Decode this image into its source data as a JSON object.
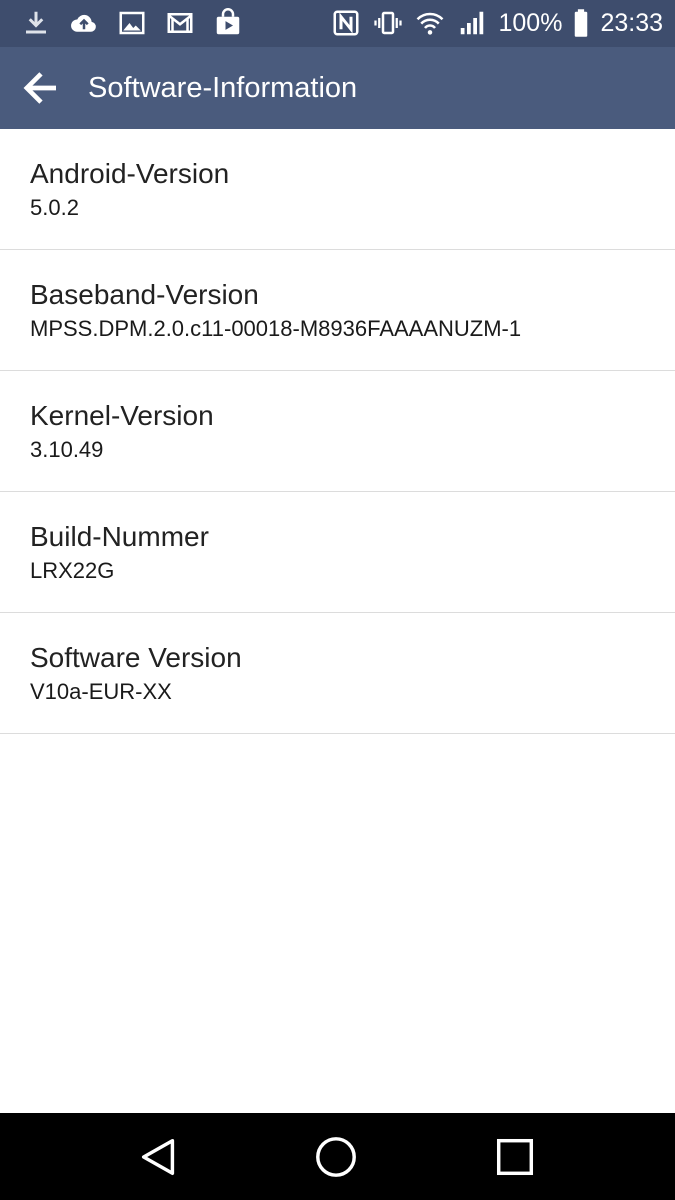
{
  "status_bar": {
    "battery_percent": "100%",
    "time": "23:33",
    "left_icons": [
      "download-icon",
      "cloud-upload-icon",
      "image-icon",
      "gmail-icon",
      "play-store-icon"
    ],
    "right_icons": [
      "nfc-icon",
      "vibrate-icon",
      "wifi-icon",
      "signal-icon",
      "battery-icon"
    ]
  },
  "action_bar": {
    "title": "Software-Information",
    "back_icon": "arrow-left-icon"
  },
  "items": [
    {
      "title": "Android-Version",
      "value": "5.0.2"
    },
    {
      "title": "Baseband-Version",
      "value": "MPSS.DPM.2.0.c11-00018-M8936FAAAANUZM-1"
    },
    {
      "title": "Kernel-Version",
      "value": "3.10.49"
    },
    {
      "title": "Build-Nummer",
      "value": "LRX22G"
    },
    {
      "title": "Software Version",
      "value": "V10a-EUR-XX"
    }
  ],
  "nav_bar": {
    "back_icon": "nav-back-triangle-icon",
    "home_icon": "nav-home-circle-icon",
    "recents_icon": "nav-recents-square-icon"
  },
  "colors": {
    "status_bar_bg": "#3e4d6d",
    "action_bar_bg": "#4a5b7d",
    "nav_bar_bg": "#000000",
    "divider": "#dcdcdc"
  }
}
